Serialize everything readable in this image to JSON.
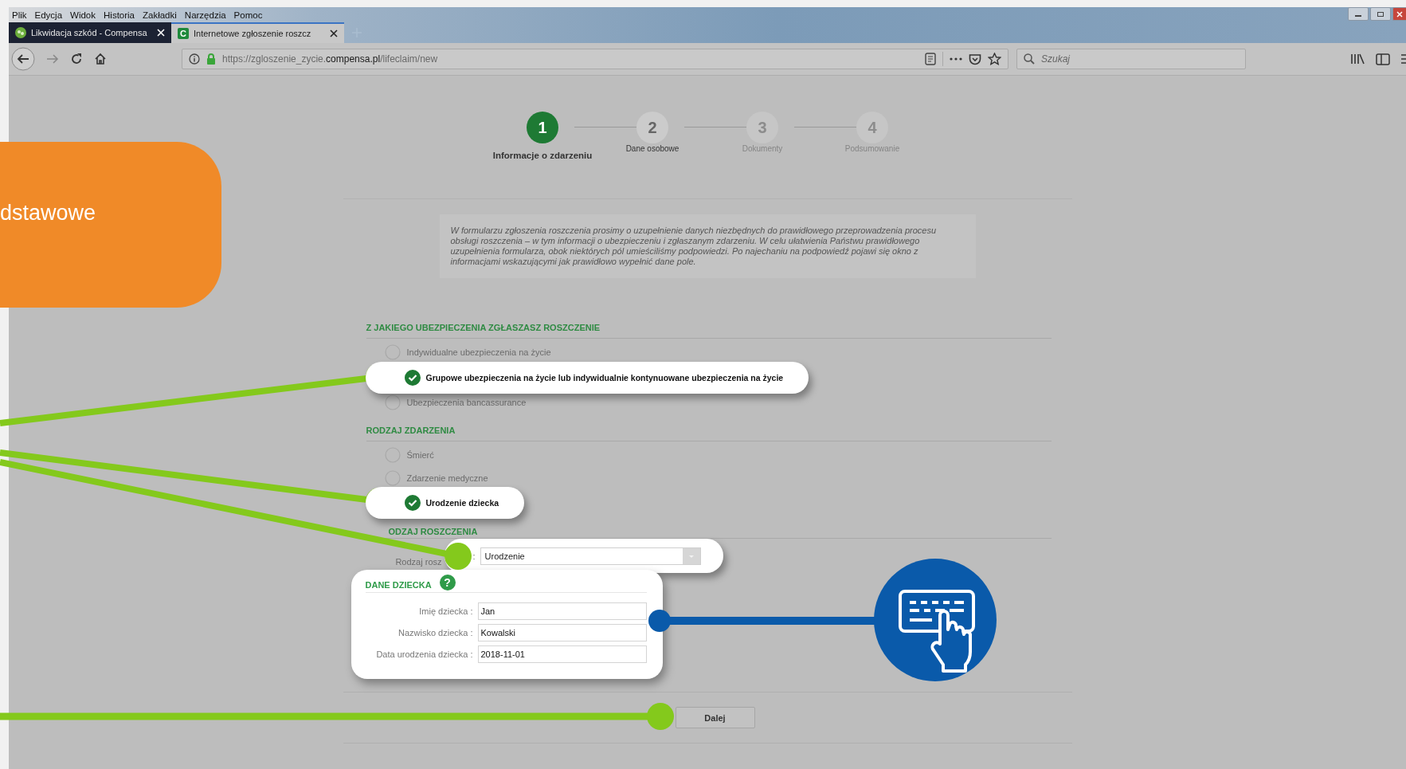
{
  "browser": {
    "menu": [
      "Plik",
      "Edycja",
      "Widok",
      "Historia",
      "Zakładki",
      "Narzędzia",
      "Pomoc"
    ],
    "tabs": [
      {
        "label": "Likwidacja szkód - Compensa",
        "selected": false
      },
      {
        "label": "Internetowe zgłoszenie roszcz",
        "icon_letter": "C",
        "selected": true
      }
    ],
    "url": "https://zgloszenie_zycie.**compensa.pl**/lifeclaim/new",
    "search": {
      "placeholder": "Szukaj"
    }
  },
  "banner": {
    "text": "dstawowe"
  },
  "steps": [
    {
      "number": "1",
      "label": "Informacje o zdarzeniu",
      "current": true,
      "disabled": false
    },
    {
      "number": "2",
      "label": "Dane osobowe",
      "current": false,
      "disabled": false
    },
    {
      "number": "3",
      "label": "Dokumenty",
      "current": false,
      "disabled": true
    },
    {
      "number": "4",
      "label": "Podsumowanie",
      "current": false,
      "disabled": true
    }
  ],
  "intro": "W formularzu zgłoszenia roszczenia prosimy o uzupełnienie danych niezbędnych do prawidłowego przeprowadzenia procesu obsługi roszczenia – w tym informacji o ubezpieczeniu i zgłaszanym zdarzeniu. W celu ułatwienia Państwu prawidłowego uzupełnienia formularza, obok niektórych pól umieściliśmy podpowiedzi. Po najechaniu na  podpowiedź pojawi się okno z informacjami wskazującymi jak prawidłowo wypełnić dane pole.",
  "sections": [
    {
      "kind": "radios",
      "title": "Z JAKIEGO UBEZPIECZENIA ZGŁASZASZ ROSZCZENIE",
      "options": [
        {
          "label": "Indywidualne ubezpieczenia na życie",
          "selected": false
        },
        {
          "label": "Grupowe ubezpieczenia na życie lub indywidualnie kontynuowane ubezpieczenia na życie",
          "selected": true
        },
        {
          "label": "Ubezpieczenia bancassurance",
          "selected": false
        }
      ]
    },
    {
      "kind": "radios",
      "title": "RODZAJ ZDARZENIA",
      "options": [
        {
          "label": "Śmierć",
          "selected": false
        },
        {
          "label": "Zdarzenie medyczne",
          "selected": false
        },
        {
          "label": "Urodzenie dziecka",
          "selected": true
        }
      ]
    },
    {
      "kind": "select",
      "title": "ODZAJ ROSZCZENIA",
      "label": "Rodzaj rosz",
      "suffix": ":",
      "value": "Urodzenie"
    },
    {
      "kind": "fields",
      "title": "DANE DZIECKA",
      "help": "?",
      "fields": [
        {
          "label": "Imię dziecka :",
          "value": "Jan"
        },
        {
          "label": "Nazwisko dziecka :",
          "value": "Kowalski"
        },
        {
          "label": "Data urodzenia dziecka :",
          "value": "2018-11-01"
        }
      ]
    }
  ],
  "next_button": "Dalej"
}
